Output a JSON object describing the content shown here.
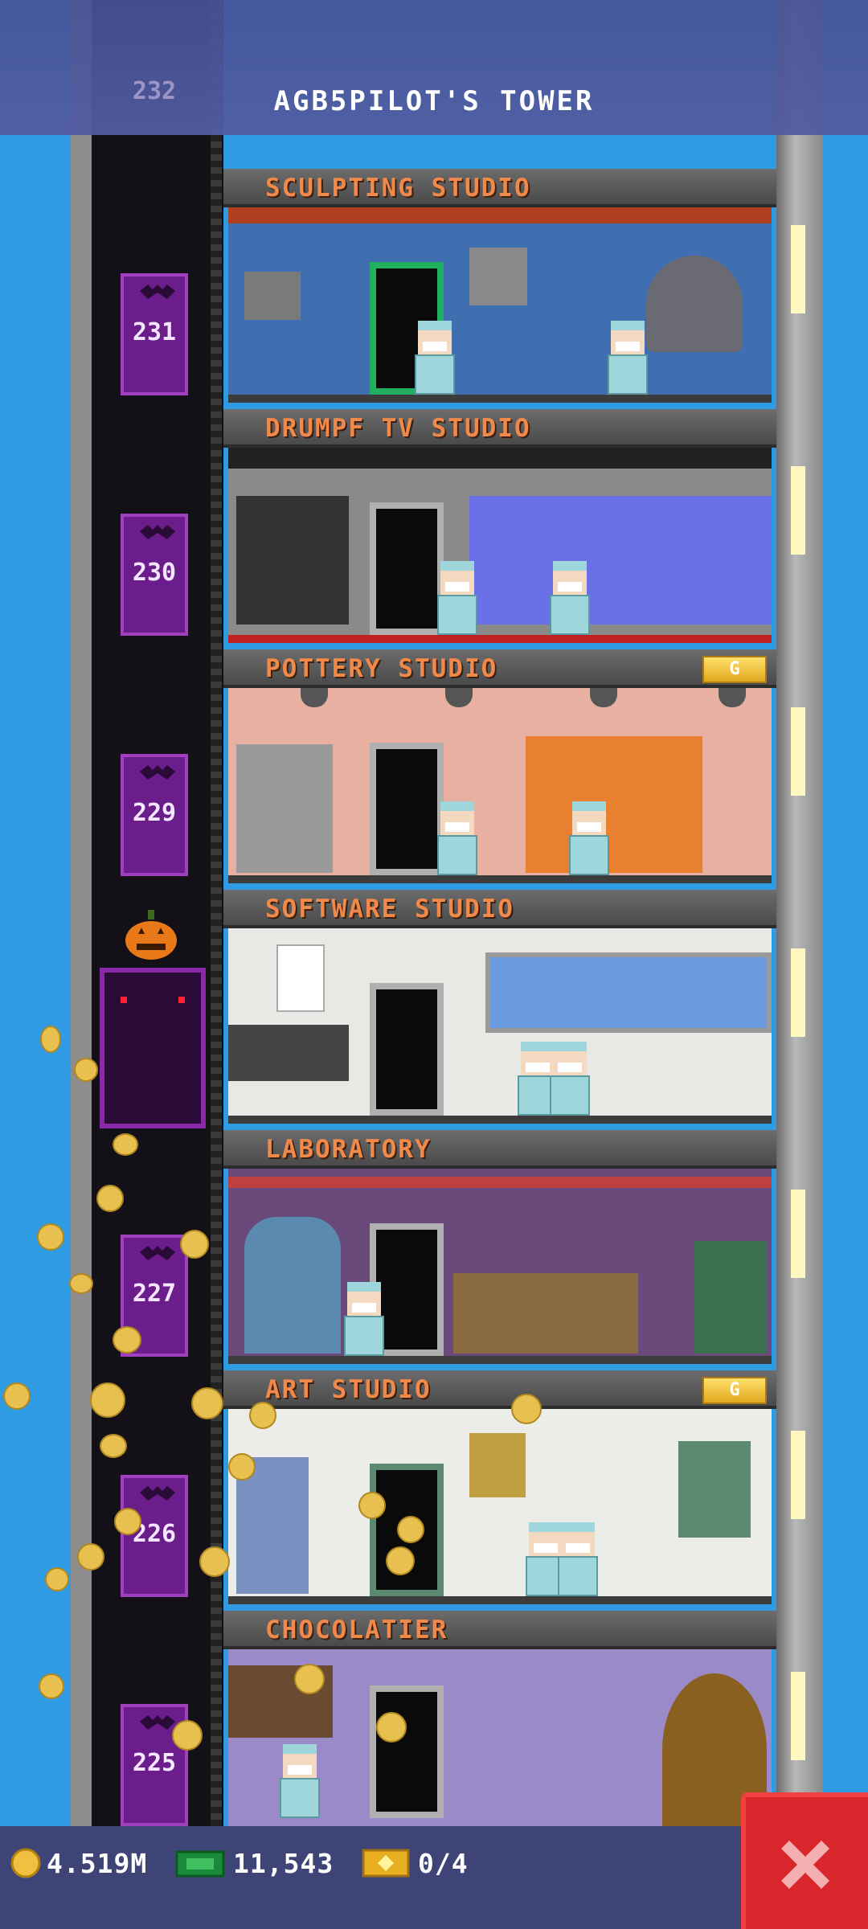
{
  "header": {
    "title": "AGB5PILOT'S TOWER",
    "top_floor_number": "232"
  },
  "elevator": {
    "floor_numbers": [
      "231",
      "230",
      "229",
      "227",
      "226",
      "225"
    ],
    "decoration": "jack-o-lantern"
  },
  "floors": [
    {
      "name": "SCULPTING STUDIO",
      "badge": ""
    },
    {
      "name": "DRUMPF TV STUDIO",
      "badge": ""
    },
    {
      "name": "POTTERY STUDIO",
      "badge": "G"
    },
    {
      "name": "SOFTWARE STUDIO",
      "badge": ""
    },
    {
      "name": "LABORATORY",
      "badge": ""
    },
    {
      "name": "ART STUDIO",
      "badge": "G"
    },
    {
      "name": "CHOCOLATIER",
      "badge": ""
    }
  ],
  "status_bar": {
    "coins": "4.519M",
    "bux": "11,543",
    "tickets": "0/4"
  },
  "colors": {
    "label_text": "#f0894a",
    "elevator_tag": "#6c1d8c",
    "close": "#d8262c",
    "bar": "#3e4476"
  }
}
